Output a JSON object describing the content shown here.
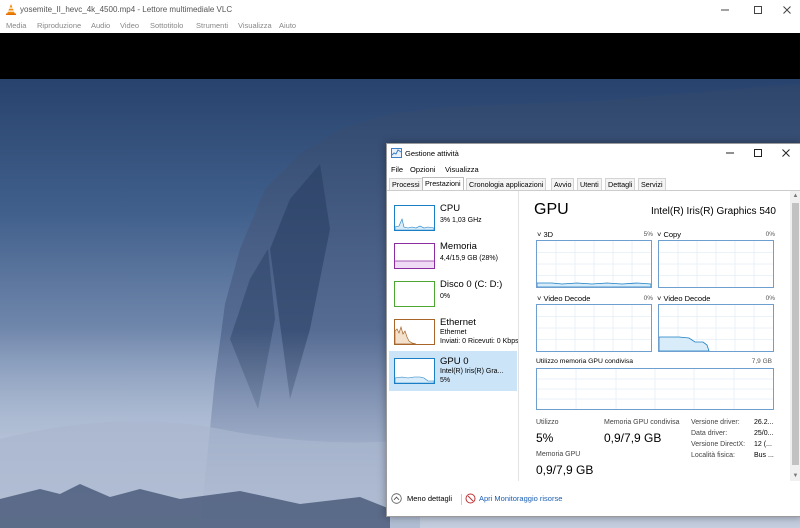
{
  "vlc": {
    "title": "yosemite_II_hevc_4k_4500.mp4 - Lettore multimediale VLC",
    "menu": [
      "Media",
      "Riproduzione",
      "Audio",
      "Video",
      "Sottotitolo",
      "Strumenti",
      "Visualizza",
      "Aiuto"
    ]
  },
  "taskmgr": {
    "title": "Gestione attività",
    "menu": [
      "File",
      "Opzioni",
      "Visualizza"
    ],
    "tabs": [
      "Processi",
      "Prestazioni",
      "Cronologia applicazioni",
      "Avvio",
      "Utenti",
      "Dettagli",
      "Servizi"
    ],
    "active_tab": "Prestazioni",
    "resources": [
      {
        "name": "CPU",
        "sub1": "3% 1,03 GHz",
        "sub2": "",
        "color": "#1a7fc4"
      },
      {
        "name": "Memoria",
        "sub1": "4,4/15,9 GB (28%)",
        "sub2": "",
        "color": "#8b2ca0"
      },
      {
        "name": "Disco 0 (C: D:)",
        "sub1": "0%",
        "sub2": "",
        "color": "#4da630"
      },
      {
        "name": "Ethernet",
        "sub1": "Ethernet",
        "sub2": "Inviati: 0 Ricevuti: 0 Kbps",
        "color": "#a7652a"
      },
      {
        "name": "GPU 0",
        "sub1": "Intel(R) Iris(R) Gra...",
        "sub2": "5%",
        "color": "#1a7fc4"
      }
    ],
    "gpu": {
      "title": "GPU",
      "model": "Intel(R) Iris(R) Graphics 540",
      "engines": [
        {
          "label": "3D",
          "pct": "5%"
        },
        {
          "label": "Copy",
          "pct": "0%"
        },
        {
          "label": "Video Decode",
          "pct": "0%"
        },
        {
          "label": "Video Decode",
          "pct": "0%"
        }
      ],
      "shared_label": "Utilizzo memoria GPU condivisa",
      "shared_max": "7,9 GB",
      "utilizzo_label": "Utilizzo",
      "utilizzo_value": "5%",
      "mem_shared_label": "Memoria GPU condivisa",
      "mem_shared_value": "0,9/7,9 GB",
      "mem_gpu_label": "Memoria GPU",
      "mem_gpu_value": "0,9/7,9 GB",
      "info": [
        {
          "label": "Versione driver:",
          "value": "26.2..."
        },
        {
          "label": "Data driver:",
          "value": "25/0..."
        },
        {
          "label": "Versione DirectX:",
          "value": "12 (..."
        },
        {
          "label": "Località fisica:",
          "value": "Bus ..."
        }
      ]
    },
    "footer": {
      "less_details": "Meno dettagli",
      "open_monitor": "Apri Monitoraggio risorse"
    }
  }
}
